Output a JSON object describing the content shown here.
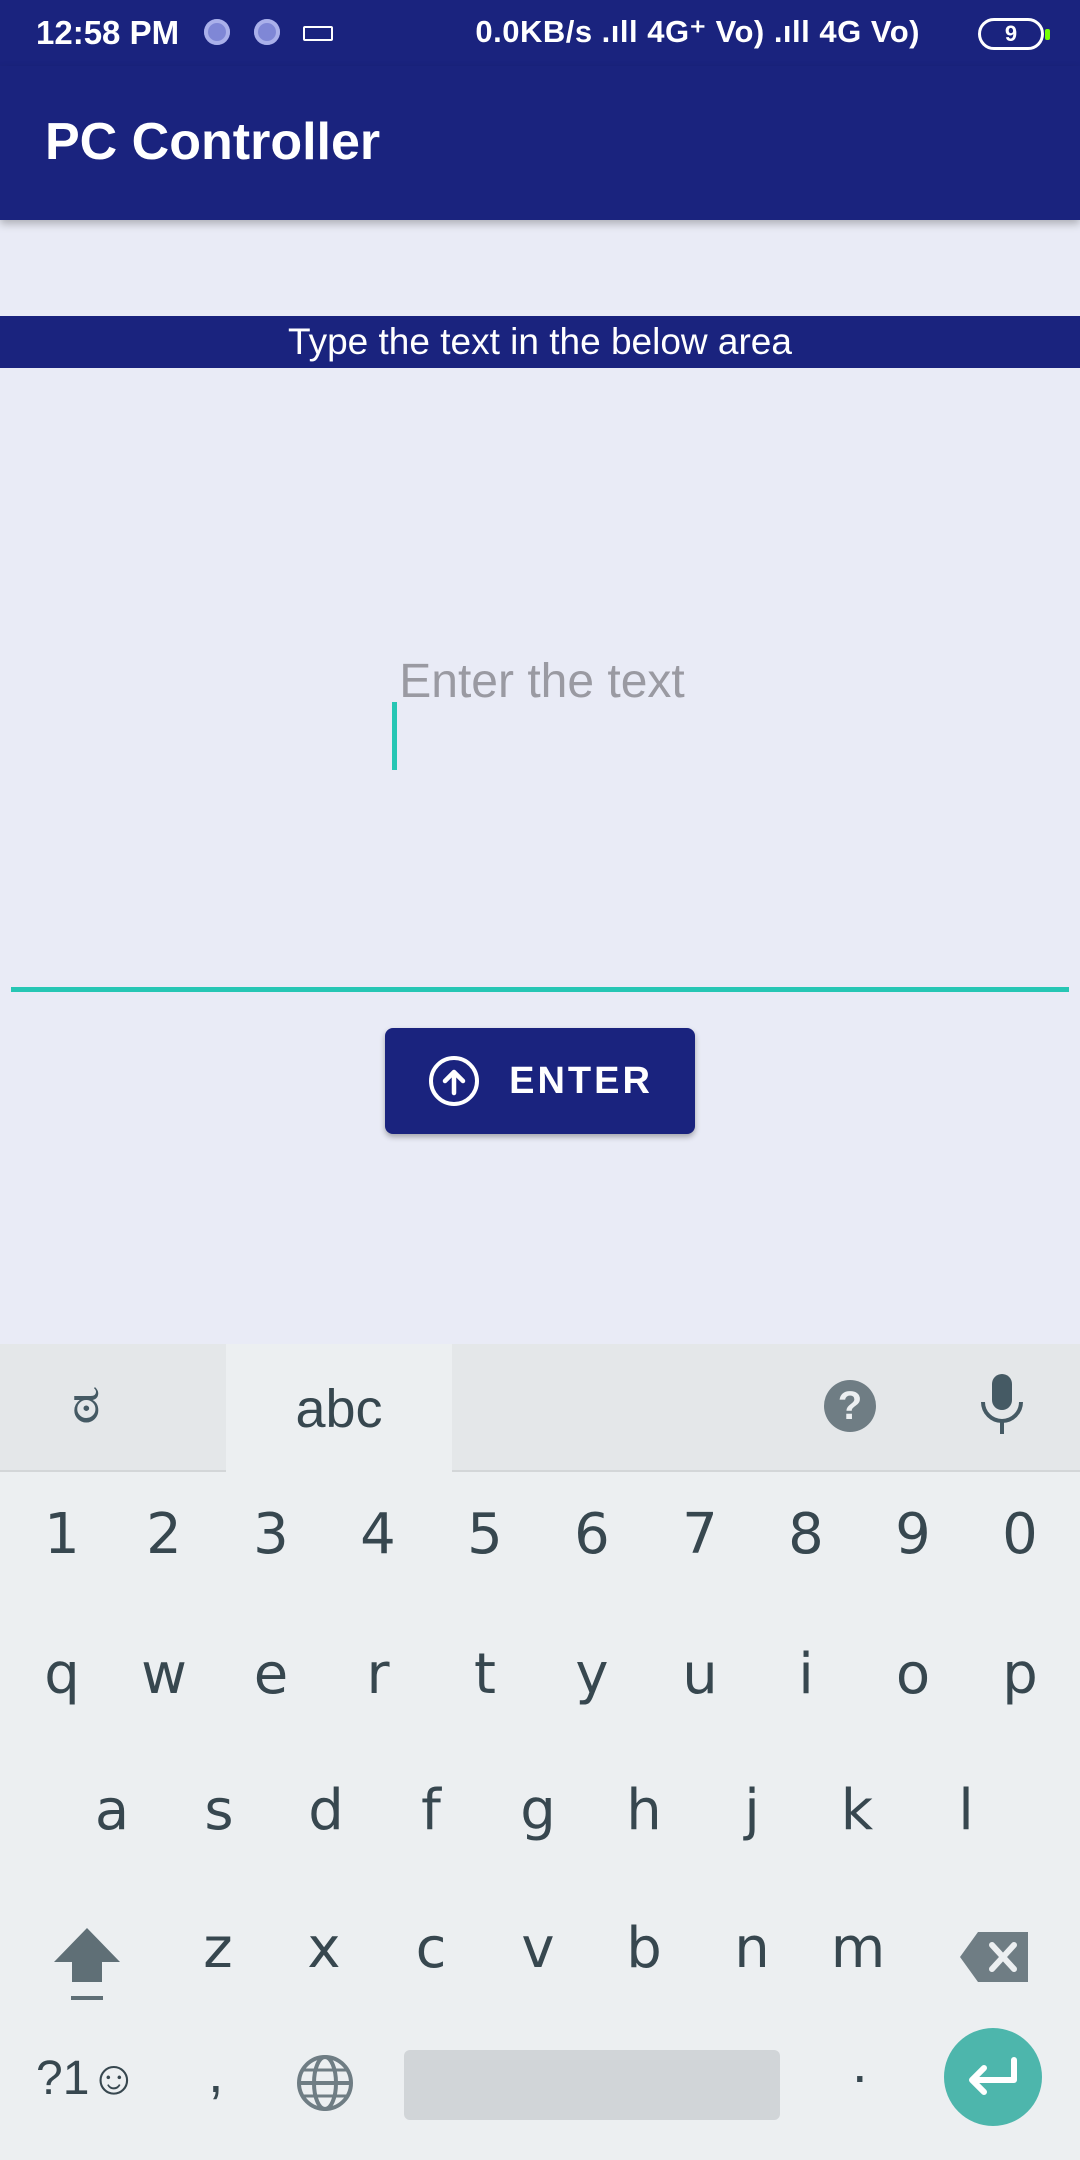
{
  "status_bar": {
    "time": "12:58 PM",
    "network": "0.0KB/s .ıll 4G⁺ Vo) .ıll 4G Vo)",
    "battery": "9"
  },
  "app_bar": {
    "title": "PC Controller"
  },
  "main": {
    "banner": "Type the text in the below area",
    "input_placeholder": "Enter the text",
    "input_value": "",
    "enter_button_label": "ENTER"
  },
  "keyboard": {
    "lang_tab": "ಠ",
    "abc_tab": "abc",
    "help_icon": "?",
    "number_row": [
      "1",
      "2",
      "3",
      "4",
      "5",
      "6",
      "7",
      "8",
      "9",
      "0"
    ],
    "row1": [
      "q",
      "w",
      "e",
      "r",
      "t",
      "y",
      "u",
      "i",
      "o",
      "p"
    ],
    "row2": [
      "a",
      "s",
      "d",
      "f",
      "g",
      "h",
      "j",
      "k",
      "l"
    ],
    "row3": [
      "z",
      "x",
      "c",
      "v",
      "b",
      "n",
      "m"
    ],
    "symbols_key": "?1☺",
    "comma_key": ",",
    "period_key": "."
  },
  "colors": {
    "primary": "#1a237e",
    "accent": "#26c6b4",
    "background": "#e9ebf6"
  }
}
